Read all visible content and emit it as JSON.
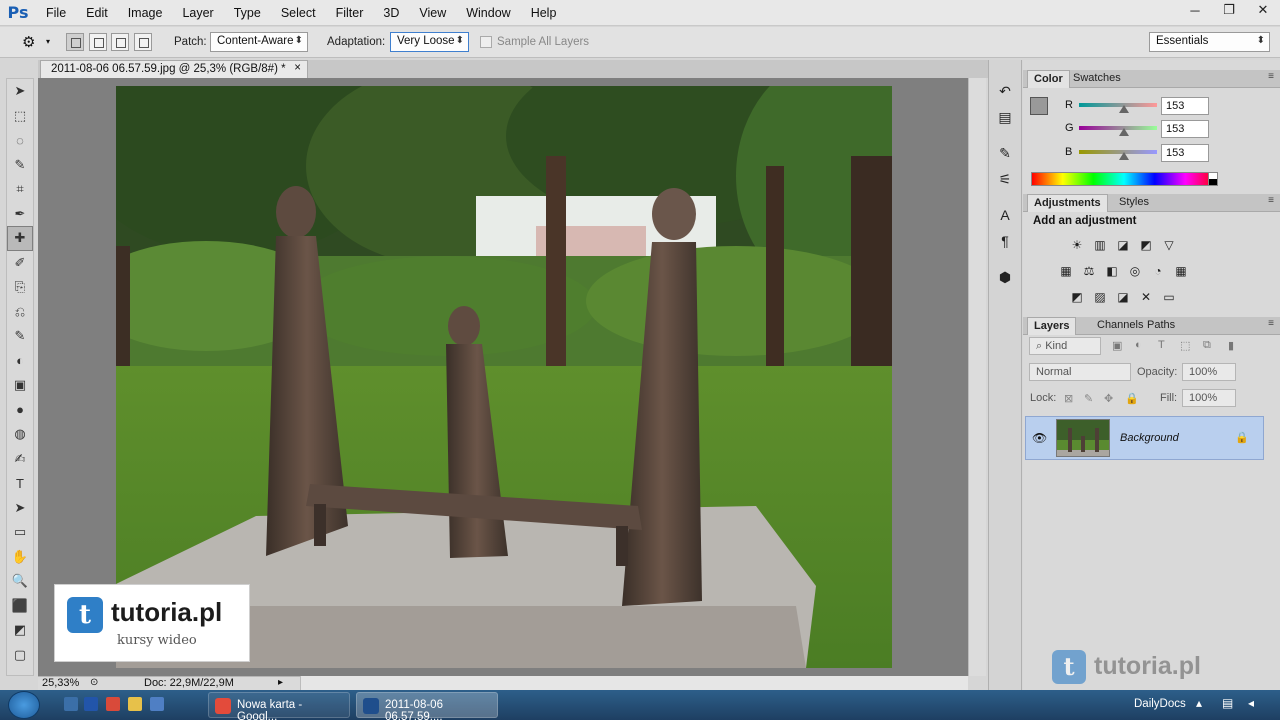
{
  "app": {
    "logo": "Ps"
  },
  "menu": [
    "File",
    "Edit",
    "Image",
    "Layer",
    "Type",
    "Select",
    "Filter",
    "3D",
    "View",
    "Window",
    "Help"
  ],
  "window_controls": [
    "─",
    "❐",
    "✕"
  ],
  "options_bar": {
    "patch_label": "Patch:",
    "patch_value": "Content-Aware",
    "adaptation_label": "Adaptation:",
    "adaptation_value": "Very Loose",
    "sample_all_layers": "Sample All Layers",
    "workspace": "Essentials"
  },
  "document": {
    "tab_title": "2011-08-06 06.57.59.jpg @ 25,3% (RGB/8#) *",
    "tab_close": "×",
    "zoom": "25,33%",
    "doc_info": "Doc: 22,9M/22,9M"
  },
  "watermark": {
    "icon_letter": "t",
    "brand": "tutoria.pl",
    "subtitle": "kursy wideo"
  },
  "color_panel": {
    "tabs": [
      "Color",
      "Swatches"
    ],
    "channels": [
      {
        "label": "R",
        "value": "153"
      },
      {
        "label": "G",
        "value": "153"
      },
      {
        "label": "B",
        "value": "153"
      }
    ],
    "foreground": "#999999"
  },
  "adjustments_panel": {
    "tabs": [
      "Adjustments",
      "Styles"
    ],
    "heading": "Add an adjustment",
    "icons_row1": [
      "☀",
      "▥",
      "◪",
      "◩",
      "▽"
    ],
    "icons_row2": [
      "▦",
      "⚖",
      "◧",
      "◎",
      "◔",
      "▦"
    ],
    "icons_row3": [
      "◩",
      "▨",
      "◪",
      "✕",
      "▭"
    ]
  },
  "layers_panel": {
    "tabs": [
      "Layers",
      "Channels",
      "Paths"
    ],
    "kind": "Kind",
    "blend_mode": "Normal",
    "opacity_label": "Opacity:",
    "opacity_value": "100%",
    "lock_label": "Lock:",
    "fill_label": "Fill:",
    "fill_value": "100%",
    "layer_name": "Background"
  },
  "tools": [
    "➤",
    "⬚",
    "◌",
    "✎",
    "⌗",
    "✒",
    "✚",
    "✐",
    "⎘",
    "⎌",
    "✎",
    "◐",
    "▣",
    "●",
    "◍",
    "✍",
    "T",
    "➤",
    "▭",
    "✋",
    "🔍",
    "⬛",
    "◩",
    "▢"
  ],
  "taskbar": {
    "tasks": [
      "Nowa karta - Googl...",
      "2011-08-06 06.57.59...."
    ],
    "tray": "DailyDocs"
  }
}
